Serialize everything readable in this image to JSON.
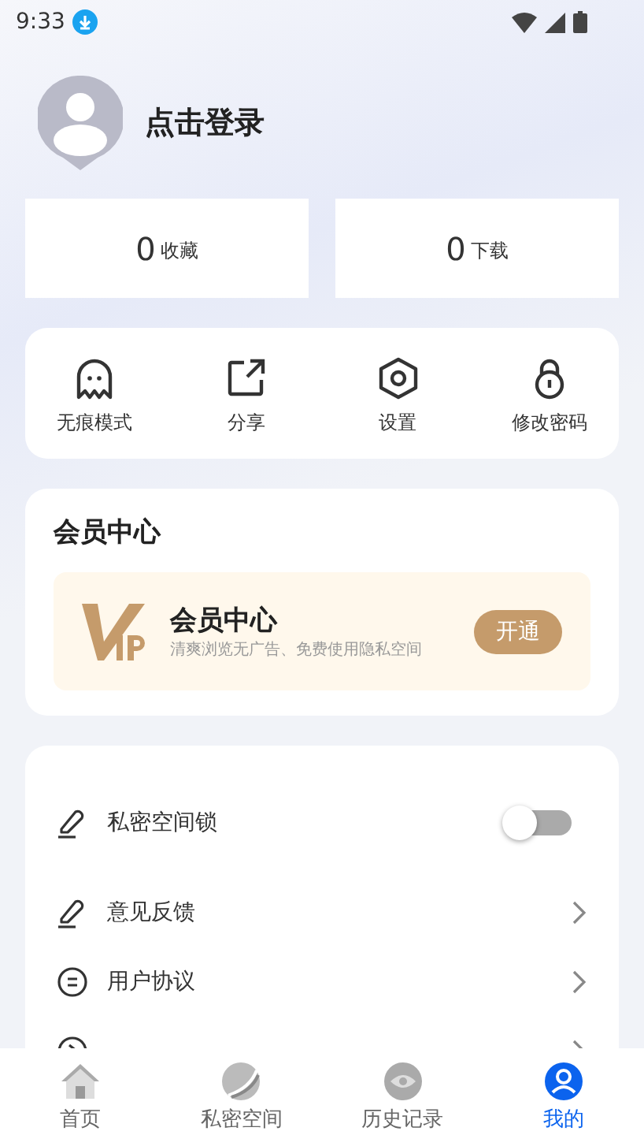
{
  "status_bar": {
    "time": "9:33"
  },
  "profile": {
    "name": "点击登录"
  },
  "stats": [
    {
      "count": "0",
      "label": "收藏"
    },
    {
      "count": "0",
      "label": "下载"
    }
  ],
  "tools": [
    {
      "kind": "ghost",
      "label": "无痕模式"
    },
    {
      "kind": "share",
      "label": "分享"
    },
    {
      "kind": "settings",
      "label": "设置"
    },
    {
      "kind": "lock",
      "label": "修改密码"
    }
  ],
  "vip": {
    "heading": "会员中心",
    "title": "会员中心",
    "subtitle": "清爽浏览无广告、免费使用隐私空间",
    "button": "开通"
  },
  "menu": [
    {
      "kind": "toggle",
      "label": "私密空间锁",
      "on": false
    },
    {
      "kind": "link",
      "label": "意见反馈"
    },
    {
      "kind": "link",
      "label": "用户协议"
    },
    {
      "kind": "link"
    }
  ],
  "tab_bar": [
    {
      "kind": "home",
      "label": "首页",
      "selected": false
    },
    {
      "kind": "planet",
      "label": "私密空间",
      "selected": false
    },
    {
      "kind": "eye",
      "label": "历史记录",
      "selected": false
    },
    {
      "kind": "user",
      "label": "我的",
      "selected": true
    }
  ]
}
